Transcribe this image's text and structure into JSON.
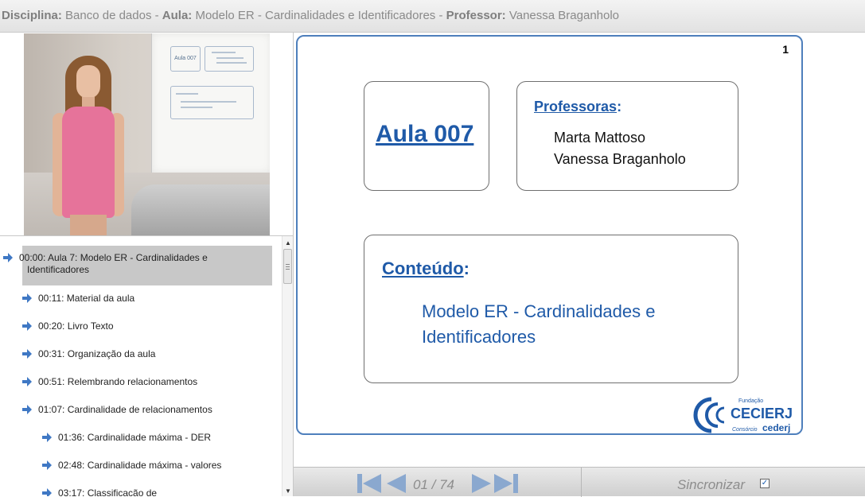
{
  "header": {
    "disciplina_label": "Disciplina:",
    "disciplina_value": "Banco de dados",
    "aula_label": "Aula:",
    "aula_value": "Modelo ER - Cardinalidades e Identificadores",
    "professor_label": "Professor:",
    "professor_value": "Vanessa Braganholo",
    "sep": " - "
  },
  "video": {
    "screen_box_title": "Aula 007"
  },
  "toc": {
    "items": [
      {
        "time_label": "00:00: Aula 7: Modelo ER - Cardinalidades e",
        "line2": "Identificadores",
        "active": true
      },
      {
        "time_label": "00:11: Material da aula"
      },
      {
        "time_label": "00:20: Livro Texto"
      },
      {
        "time_label": "00:31: Organização da aula"
      },
      {
        "time_label": "00:51: Relembrando relacionamentos"
      },
      {
        "time_label": "01:07: Cardinalidade de relacionamentos"
      },
      {
        "time_label": "01:36: Cardinalidade máxima - DER"
      },
      {
        "time_label": "02:48: Cardinalidade máxima - valores"
      },
      {
        "time_label": "03:17: Classificação de"
      }
    ]
  },
  "slide": {
    "number": "1",
    "aula_title": "Aula 007",
    "professoras_label": "Professoras",
    "professoras_colon": ":",
    "professoras": [
      "Marta Mattoso",
      "Vanessa Braganholo"
    ],
    "conteudo_label": "Conteúdo",
    "conteudo_colon": ":",
    "conteudo_text_line1": "Modelo ER - Cardinalidades e",
    "conteudo_text_line2": "Identificadores",
    "logo_small": "Fundação",
    "logo_main": "CECIERJ",
    "logo_sub_prefix": "Consórcio",
    "logo_sub": "cederj"
  },
  "controls": {
    "page_indicator": "01 / 74",
    "sync_label": "Sincronizar",
    "sync_checked": true
  },
  "colors": {
    "accent_blue": "#1f5aa8",
    "slide_border": "#4e7fbc",
    "arrow_blue": "#3f78c4"
  }
}
